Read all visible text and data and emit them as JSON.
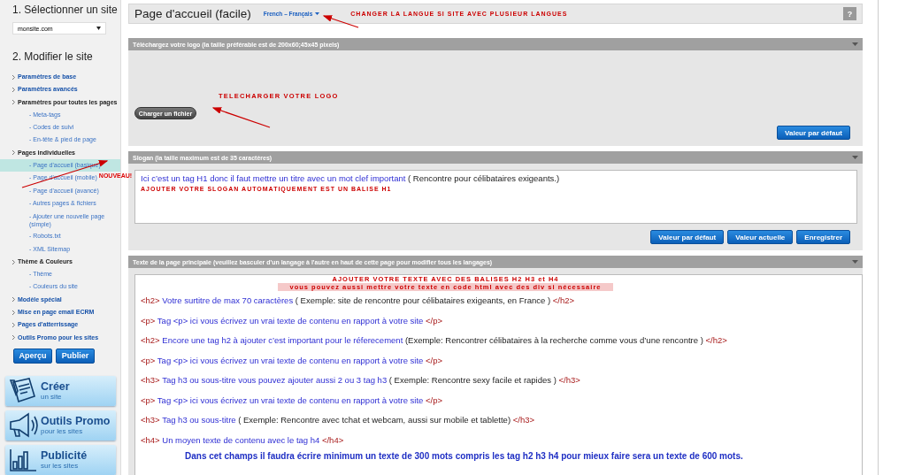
{
  "sidebar": {
    "step1_title": "1. Sélectionner un site",
    "site_select": {
      "value": "monsite.com"
    },
    "step2_title": "2. Modifier le site",
    "nav": [
      {
        "label": "Paramètres de base",
        "kind": "link",
        "selected": false
      },
      {
        "label": "Paramètres avancés",
        "kind": "link",
        "selected": false
      },
      {
        "label": "Paramètres pour toutes les pages",
        "kind": "group",
        "selected": false,
        "children": [
          {
            "label": "- Meta-tags",
            "selected": false
          },
          {
            "label": "- Codes de suivi",
            "selected": false
          },
          {
            "label": "- En-tête & pied de page",
            "selected": false
          }
        ]
      },
      {
        "label": "Pages individuelles",
        "kind": "group",
        "selected": false,
        "children": [
          {
            "label": "- Page d'accueil (basique)",
            "selected": true
          },
          {
            "label": "- Page d'accueil (mobile)",
            "selected": false,
            "badge": "NOUVEAU!"
          },
          {
            "label": "- Page d'accueil (avancé)",
            "selected": false
          },
          {
            "label": "- Autres pages & fichiers",
            "selected": false
          },
          {
            "label": "- Ajouter une nouvelle page (simple)",
            "selected": false
          },
          {
            "label": "- Robots.txt",
            "selected": false
          },
          {
            "label": "- XML Sitemap",
            "selected": false
          }
        ]
      },
      {
        "label": "Thème & Couleurs",
        "kind": "group",
        "selected": false,
        "children": [
          {
            "label": "- Thème",
            "selected": false
          },
          {
            "label": "- Couleurs du site",
            "selected": false
          }
        ]
      },
      {
        "label": "Modèle spécial",
        "kind": "link",
        "selected": false
      },
      {
        "label": "Mise en page email ECRM",
        "kind": "link",
        "selected": false
      },
      {
        "label": "Pages d'atterrissage",
        "kind": "link",
        "selected": false
      },
      {
        "label": "Outils Promo pour les sites",
        "kind": "link",
        "selected": false
      }
    ],
    "buttons": [
      "Aperçu",
      "Publier"
    ],
    "promo_cards": [
      {
        "kind": "create",
        "title": "Créer",
        "subtitle": "un site"
      },
      {
        "kind": "promo",
        "title": "Outils Promo",
        "subtitle": "pour les sites"
      },
      {
        "kind": "ads",
        "title": "Publicité",
        "subtitle": "sur les sites"
      }
    ]
  },
  "header": {
    "title": "Page d'accueil (facile)",
    "language": "French – Français",
    "annotation": "CHANGER LA LANGUE SI SITE AVEC PLUSIEUR LANGUES",
    "help": "?"
  },
  "logo_section": {
    "title": "Téléchargez votre logo (la taille préférable est de 200x60;45x45 pixels)",
    "annotation": "TELECHARGER VOTRE LOGO",
    "upload_button": "Charger un fichier",
    "buttons": [
      "Valeur par défaut"
    ]
  },
  "slogan_section": {
    "title": "Slogan (la taille maximum est de 35 caractères)",
    "value": [
      {
        "kind": "text",
        "text": "Ici c’est un tag H1  donc il faut mettre un titre avec un mot clef important"
      },
      {
        "kind": "example",
        "text": "( Rencontre pour célibataires exigeants.)"
      }
    ],
    "annotation": "AJOUTER VOTRE SLOGAN AUTOMATIQUEMENT EST UN BALISE H1",
    "buttons": [
      "Valeur par défaut",
      "Valeur actuelle",
      "Enregistrer"
    ]
  },
  "content_section": {
    "title": "Texte de la page principale (veuillez basculer d'un langage à l'autre en haut de cette page pour modifier tous les langages)",
    "annotations": [
      {
        "kind": "plain",
        "text": "AJOUTER VOTRE TEXTE AVEC DES BALISES H2 H3 et H4"
      },
      {
        "kind": "highlight",
        "text": "vous pouvez aussi mettre votre texte en code html avec des div si nécessaire"
      }
    ],
    "lines": [
      {
        "kind": "code",
        "segments": [
          {
            "kind": "tag",
            "text": "<h2>"
          },
          {
            "kind": "text",
            "text": "Votre surtitre de max 70 caractères"
          },
          {
            "kind": "example",
            "text": "( Exemple: site de rencontre pour célibataires exigeants, en France )"
          },
          {
            "kind": "tag",
            "text": "</h2>"
          }
        ]
      },
      {
        "kind": "code",
        "segments": [
          {
            "kind": "tag",
            "text": "<p>"
          },
          {
            "kind": "text",
            "text": "Tag <p> ici vous écrivez un vrai texte de contenu en rapport à votre site"
          },
          {
            "kind": "tag",
            "text": "</p>"
          }
        ]
      },
      {
        "kind": "code",
        "segments": [
          {
            "kind": "tag",
            "text": "<h2>"
          },
          {
            "kind": "text",
            "text": "Encore une tag h2 à ajouter c’est important pour le réferecement"
          },
          {
            "kind": "example",
            "text": "(Exemple: Rencontrer célibataires à la recherche comme vous d’une rencontre )"
          },
          {
            "kind": "tag",
            "text": "</h2>"
          }
        ]
      },
      {
        "kind": "code",
        "segments": [
          {
            "kind": "tag",
            "text": "<p>"
          },
          {
            "kind": "text",
            "text": "Tag <p> ici vous écrivez un vrai texte de contenu en rapport à votre site"
          },
          {
            "kind": "tag",
            "text": "</p>"
          }
        ]
      },
      {
        "kind": "code",
        "segments": [
          {
            "kind": "tag",
            "text": "<h3>"
          },
          {
            "kind": "text",
            "text": "Tag h3 ou sous-titre vous pouvez ajouter aussi 2 ou 3 tag h3"
          },
          {
            "kind": "example",
            "text": "( Exemple: Rencontre sexy facile et rapides )"
          },
          {
            "kind": "tag",
            "text": "</h3>"
          }
        ]
      },
      {
        "kind": "code",
        "segments": [
          {
            "kind": "tag",
            "text": "<p>"
          },
          {
            "kind": "text",
            "text": "Tag <p> ici vous écrivez un vrai texte de contenu en rapport à votre site"
          },
          {
            "kind": "tag",
            "text": "</p>"
          }
        ]
      },
      {
        "kind": "code",
        "segments": [
          {
            "kind": "tag",
            "text": "<h3>"
          },
          {
            "kind": "text",
            "text": "Tag h3 ou sous-titre"
          },
          {
            "kind": "example",
            "text": "( Exemple: Rencontre avec tchat et webcam, aussi sur mobile et tablette)"
          },
          {
            "kind": "tag",
            "text": "</h3>"
          }
        ]
      },
      {
        "kind": "code",
        "segments": [
          {
            "kind": "tag",
            "text": "<h4>"
          },
          {
            "kind": "text",
            "text": "Un moyen texte de contenu avec le tag h4"
          },
          {
            "kind": "tag",
            "text": "</h4>"
          }
        ]
      },
      {
        "kind": "note",
        "segments": [
          {
            "kind": "text",
            "text": "Dans cet champs il faudra écrire minimum un texte de 300 mots compris les tag h2 h3 h4 pour mieux faire sera un texte de 600 mots."
          }
        ]
      }
    ]
  }
}
